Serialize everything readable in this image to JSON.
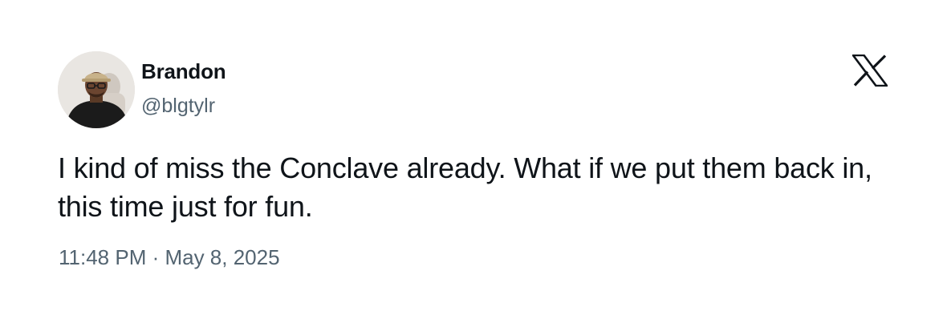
{
  "author": {
    "name": "Brandon",
    "handle": "@blgtylr"
  },
  "tweet": {
    "text": "I kind of miss the Conclave already. What if we put them back in, this time just for fun.",
    "timestamp": "11:48 PM · May 8, 2025"
  },
  "icons": {
    "brand": "x-logo-icon",
    "avatar": "profile-photo"
  },
  "colors": {
    "primary_text": "#0f1419",
    "secondary_text": "#536471",
    "background": "#ffffff"
  }
}
